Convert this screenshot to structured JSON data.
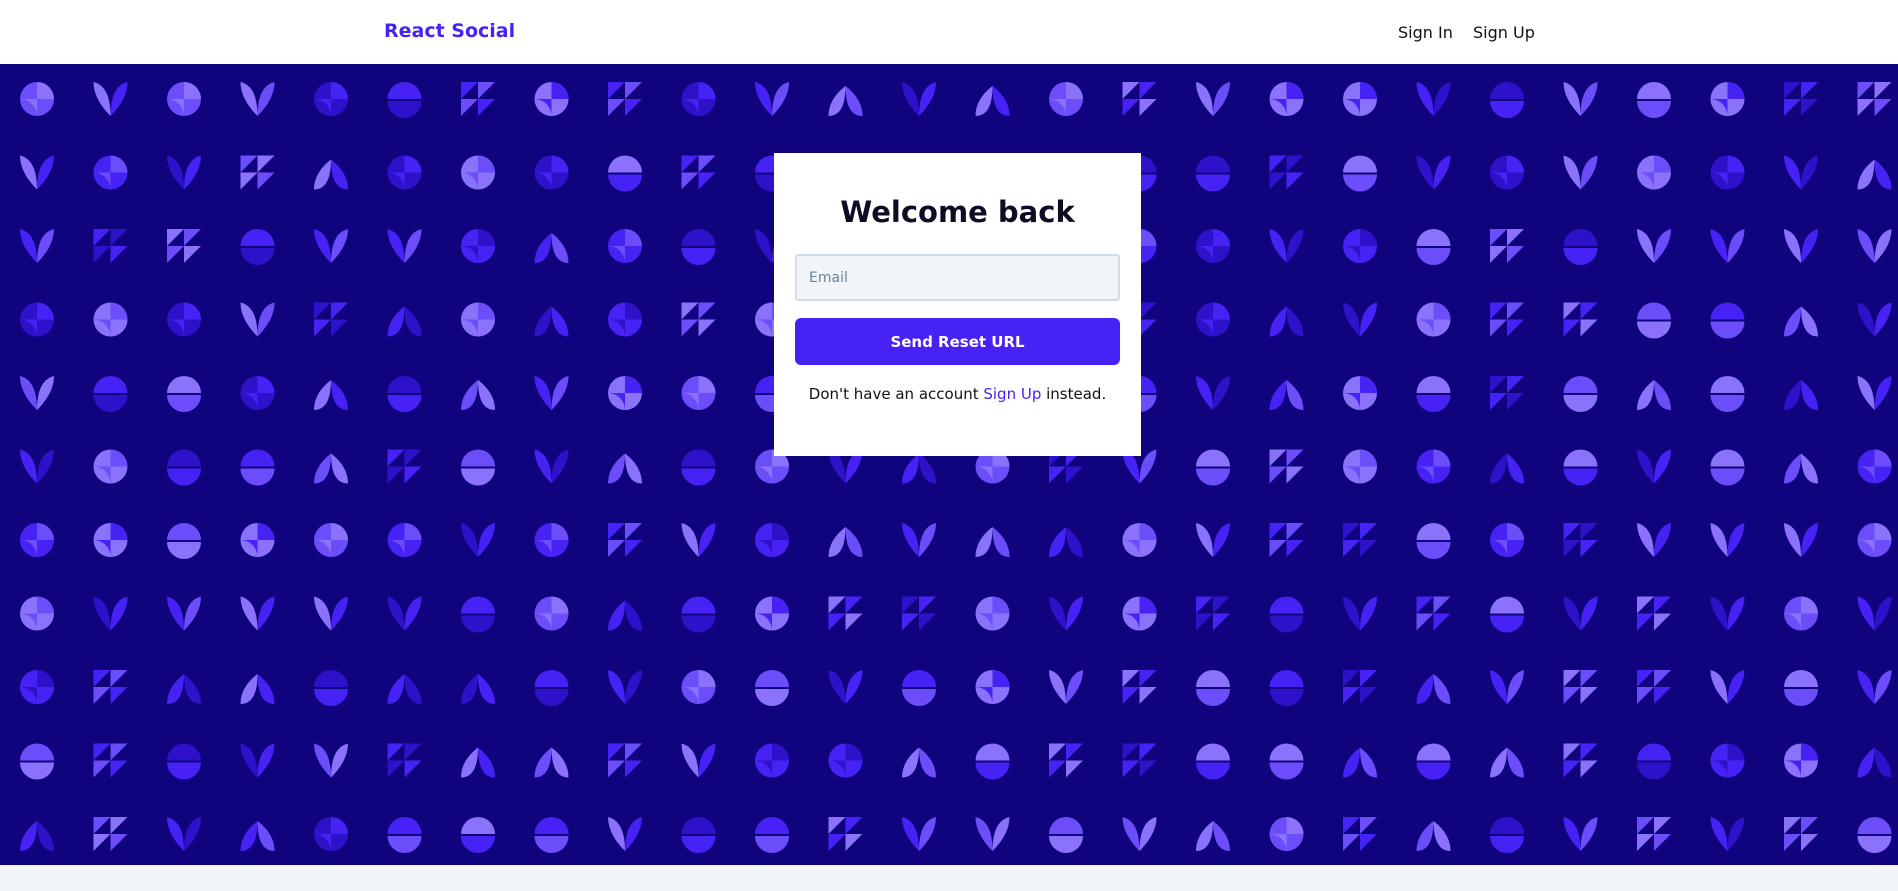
{
  "navbar": {
    "brand": "React Social",
    "sign_in": "Sign In",
    "sign_up": "Sign Up"
  },
  "card": {
    "title": "Welcome back",
    "email_placeholder": "Email",
    "email_value": "",
    "submit_label": "Send Reset URL",
    "footer_prefix": "Don't have an account ",
    "footer_link": "Sign Up",
    "footer_suffix": " instead."
  },
  "colors": {
    "accent": "#4622f5",
    "hero_background": "#10047e",
    "footer_background": "#f3f6f9"
  },
  "background_pattern": {
    "description_icons": [
      "leaf-pair-icon",
      "half-circle-icon",
      "quarter-circle-icon",
      "triangle-grid-icon"
    ]
  }
}
